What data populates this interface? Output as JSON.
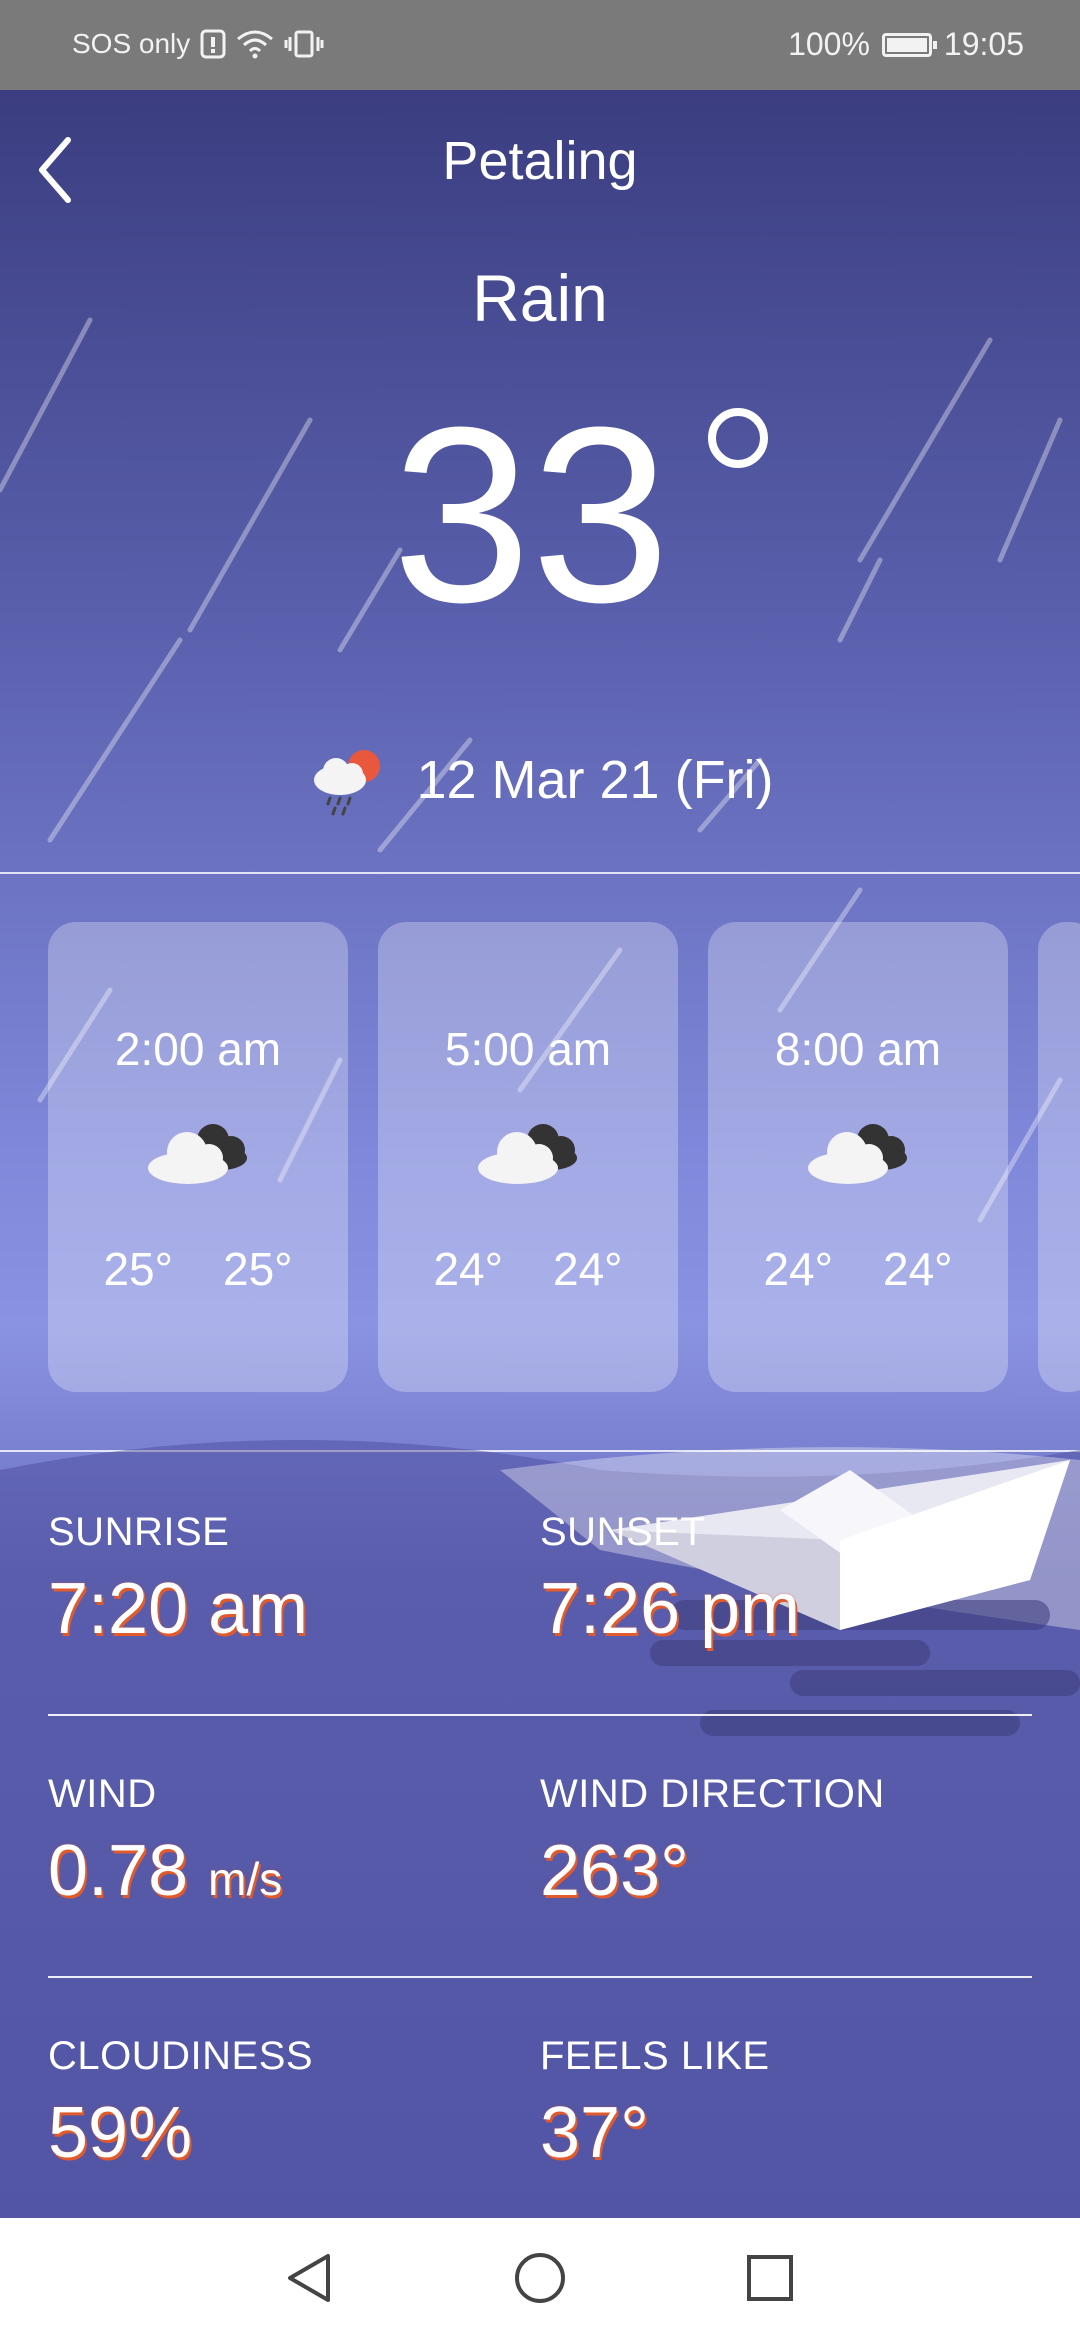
{
  "status_bar": {
    "carrier": "SOS only",
    "battery": "100%",
    "time": "19:05"
  },
  "header": {
    "city": "Petaling",
    "condition": "Rain",
    "temperature": "33",
    "date": "12 Mar 21 (Fri)",
    "date_icon": "rain-cloud-sun-icon"
  },
  "hourly": [
    {
      "time": "2:00 am",
      "low": "25°",
      "high": "25°",
      "icon": "cloudy-icon"
    },
    {
      "time": "5:00 am",
      "low": "24°",
      "high": "24°",
      "icon": "cloudy-icon"
    },
    {
      "time": "8:00 am",
      "low": "24°",
      "high": "24°",
      "icon": "cloudy-icon"
    }
  ],
  "details": {
    "sunrise": {
      "label": "SUNRISE",
      "value": "7:20 am"
    },
    "sunset": {
      "label": "SUNSET",
      "value": "7:26 pm"
    },
    "wind": {
      "label": "WIND",
      "value": "0.78",
      "unit": "m/s"
    },
    "wind_direction": {
      "label": "WIND DIRECTION",
      "value": "263°"
    },
    "cloudiness": {
      "label": "CLOUDINESS",
      "value": "59%"
    },
    "feels_like": {
      "label": "FEELS LIKE",
      "value": "37°"
    }
  },
  "colors": {
    "accent_shadow": "#e05a2c",
    "status_bar": "#7a7a7a"
  }
}
